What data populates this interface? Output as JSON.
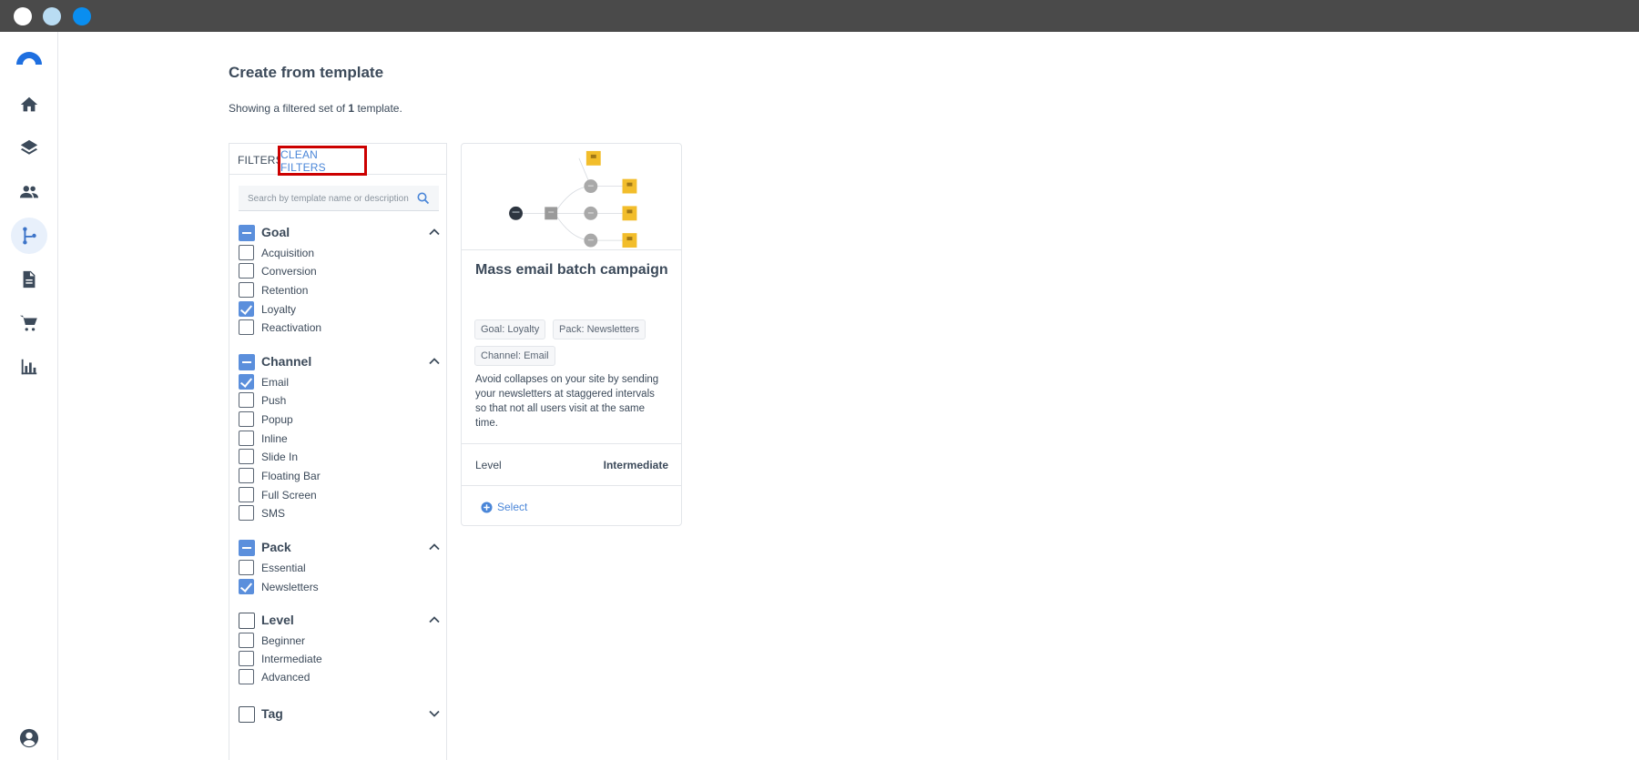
{
  "page": {
    "title": "Create from template",
    "subtitle_prefix": "Showing a filtered set of ",
    "subtitle_count": "1",
    "subtitle_suffix": " template."
  },
  "sidebar": {
    "items": [
      {
        "name": "home-icon"
      },
      {
        "name": "layers-icon"
      },
      {
        "name": "people-icon"
      },
      {
        "name": "flow-icon",
        "active": true
      },
      {
        "name": "document-icon"
      },
      {
        "name": "cart-icon"
      },
      {
        "name": "chart-icon"
      }
    ],
    "accent": "#3d74c8"
  },
  "filters": {
    "title": "FILTERS",
    "clean_label": "CLEAN FILTERS",
    "search_placeholder": "Search by template name or description",
    "groups": {
      "goal": {
        "label": "Goal",
        "options": [
          "Acquisition",
          "Conversion",
          "Retention",
          "Loyalty",
          "Reactivation"
        ],
        "checked": [
          "Loyalty"
        ]
      },
      "channel": {
        "label": "Channel",
        "options": [
          "Email",
          "Push",
          "Popup",
          "Inline",
          "Slide In",
          "Floating Bar",
          "Full Screen",
          "SMS"
        ],
        "checked": [
          "Email"
        ]
      },
      "pack": {
        "label": "Pack",
        "options": [
          "Essential",
          "Newsletters"
        ],
        "checked": [
          "Newsletters"
        ]
      },
      "level": {
        "label": "Level",
        "options": [
          "Beginner",
          "Intermediate",
          "Advanced"
        ],
        "checked": []
      },
      "tag": {
        "label": "Tag"
      }
    }
  },
  "card": {
    "title": "Mass email batch campaign",
    "tags": [
      "Goal: Loyalty",
      "Pack: Newsletters",
      "Channel: Email"
    ],
    "description": "Avoid collapses on your site by sending your newsletters at staggered intervals so that not all users visit at the same time.",
    "level_label": "Level",
    "level_value": "Intermediate",
    "select_label": "Select"
  },
  "colors": {
    "highlight": "#cc0000",
    "link": "#4a86d8",
    "checkbox": "#5b8fdc",
    "node_yellow": "#f2bd2b"
  }
}
